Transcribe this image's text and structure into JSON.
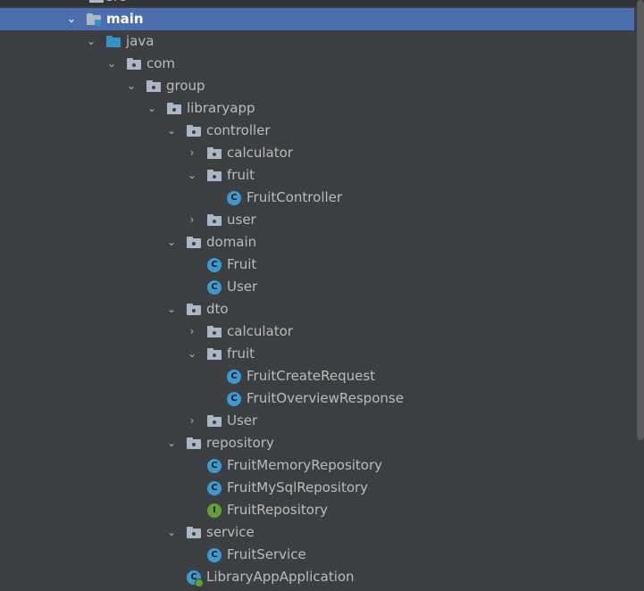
{
  "tree": {
    "src_label": "src",
    "main_label": "main",
    "java_label": "java",
    "com_label": "com",
    "group_label": "group",
    "libraryapp_label": "libraryapp",
    "controller_label": "controller",
    "controller_calculator_label": "calculator",
    "controller_fruit_label": "fruit",
    "fruit_controller_label": "FruitController",
    "controller_user_label": "user",
    "domain_label": "domain",
    "domain_fruit_label": "Fruit",
    "domain_user_label": "User",
    "dto_label": "dto",
    "dto_calculator_label": "calculator",
    "dto_fruit_label": "fruit",
    "fruit_create_request_label": "FruitCreateRequest",
    "fruit_overview_response_label": "FruitOverviewResponse",
    "dto_user_label": "User",
    "repository_label": "repository",
    "fruit_memory_repository_label": "FruitMemoryRepository",
    "fruit_mysql_repository_label": "FruitMySqlRepository",
    "fruit_repository_label": "FruitRepository",
    "service_label": "service",
    "fruit_service_label": "FruitService",
    "library_app_application_label": "LibraryAppApplication"
  },
  "badges": {
    "class_letter": "C",
    "interface_letter": "I"
  },
  "colors": {
    "background": "#3c3f41",
    "selection": "#4b6eaf",
    "class_badge": "#3d9ad1",
    "interface_badge": "#62a033",
    "source_folder": "#3592c4"
  }
}
